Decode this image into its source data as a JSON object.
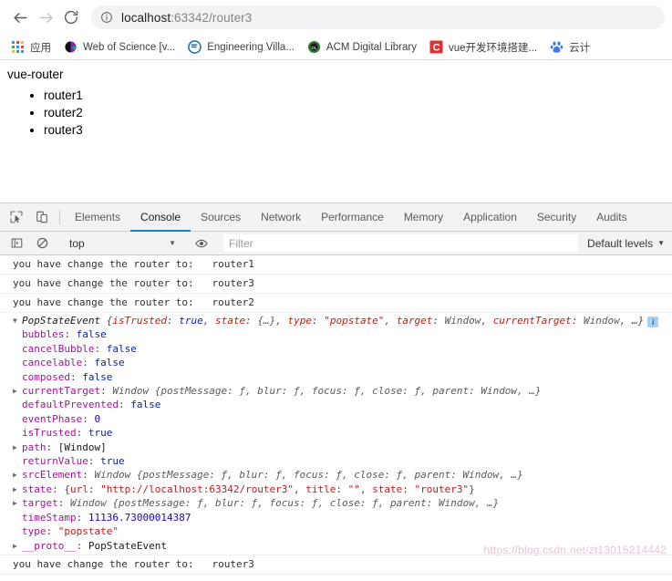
{
  "browser": {
    "back_label": "Back",
    "forward_label": "Forward",
    "reload_label": "Reload",
    "site_info_label": "View site information",
    "url_host": "localhost",
    "url_rest": ":63342/router3",
    "url_full": "localhost:63342/router3"
  },
  "bookmarks": {
    "apps_label": "应用",
    "items": [
      {
        "label": "Web of Science [v...",
        "icon": "wos-icon",
        "color": "#6b2fa0"
      },
      {
        "label": "Engineering Villa...",
        "icon": "ev-icon",
        "color": "#0a6eb4"
      },
      {
        "label": "ACM Digital Library",
        "icon": "acm-icon",
        "color": "#2f7d32"
      },
      {
        "label": "vue开发环境搭建...",
        "icon": "csdn-icon",
        "color": "#e03131"
      },
      {
        "label": "云计",
        "icon": "baidu-icon",
        "color": "#3b7de0"
      }
    ]
  },
  "page": {
    "title": "vue-router",
    "links": [
      "router1",
      "router2",
      "router3"
    ]
  },
  "devtools": {
    "inspect_label": "Inspect element",
    "device_label": "Toggle device toolbar",
    "tabs": [
      {
        "label": "Elements",
        "active": false
      },
      {
        "label": "Console",
        "active": true
      },
      {
        "label": "Sources",
        "active": false
      },
      {
        "label": "Network",
        "active": false
      },
      {
        "label": "Performance",
        "active": false
      },
      {
        "label": "Memory",
        "active": false
      },
      {
        "label": "Application",
        "active": false
      },
      {
        "label": "Security",
        "active": false
      },
      {
        "label": "Audits",
        "active": false
      }
    ],
    "toolbar": {
      "sidebar_toggle_label": "Show console sidebar",
      "clear_label": "Clear console",
      "context": "top",
      "eye_label": "Create live expression",
      "filter_value": "",
      "filter_placeholder": "Filter",
      "levels_label": "Default levels",
      "caret": "▼"
    }
  },
  "console": {
    "messages": [
      {
        "kind": "log",
        "text": "you have change the router to:   router1"
      },
      {
        "kind": "log",
        "text": "you have change the router to:   router3"
      },
      {
        "kind": "log",
        "text": "you have change the router to:   router2"
      }
    ],
    "object_header": {
      "arrow": "▼",
      "class_name": "PopStateEvent",
      "preview_open": " {",
      "parts": [
        {
          "key": "isTrusted",
          "sep": ": ",
          "val": "true",
          "type": "bool",
          "tail": ", "
        },
        {
          "key": "state",
          "sep": ": ",
          "val": "{…}",
          "type": "obj",
          "tail": ", "
        },
        {
          "key": "type",
          "sep": ": ",
          "val": "\"popstate\"",
          "type": "str",
          "tail": ", "
        },
        {
          "key": "target",
          "sep": ": ",
          "val": "Window",
          "type": "objname",
          "tail": ", "
        },
        {
          "key": "currentTarget",
          "sep": ": ",
          "val": "Window",
          "type": "objname",
          "tail": ", "
        }
      ],
      "ellipsis": "…}",
      "info_badge": "i"
    },
    "properties": [
      {
        "expandable": false,
        "key": "bubbles",
        "val": "false",
        "type": "bool"
      },
      {
        "expandable": false,
        "key": "cancelBubble",
        "val": "false",
        "type": "bool"
      },
      {
        "expandable": false,
        "key": "cancelable",
        "val": "false",
        "type": "bool"
      },
      {
        "expandable": false,
        "key": "composed",
        "val": "false",
        "type": "bool"
      },
      {
        "expandable": true,
        "key": "currentTarget",
        "val": "Window {postMessage: ƒ, blur: ƒ, focus: ƒ, close: ƒ, parent: Window, …}",
        "type": "window"
      },
      {
        "expandable": false,
        "key": "defaultPrevented",
        "val": "false",
        "type": "bool"
      },
      {
        "expandable": false,
        "key": "eventPhase",
        "val": "0",
        "type": "num"
      },
      {
        "expandable": false,
        "key": "isTrusted",
        "val": "true",
        "type": "bool"
      },
      {
        "expandable": true,
        "key": "path",
        "val": "[Window]",
        "type": "plain"
      },
      {
        "expandable": false,
        "key": "returnValue",
        "val": "true",
        "type": "bool"
      },
      {
        "expandable": true,
        "key": "srcElement",
        "val": "Window {postMessage: ƒ, blur: ƒ, focus: ƒ, close: ƒ, parent: Window, …}",
        "type": "window"
      },
      {
        "expandable": true,
        "key": "state",
        "val": "{url: \"http://localhost:63342/router3\", title: \"\", state: \"router3\"}",
        "type": "state"
      },
      {
        "expandable": true,
        "key": "target",
        "val": "Window {postMessage: ƒ, blur: ƒ, focus: ƒ, close: ƒ, parent: Window, …}",
        "type": "window"
      },
      {
        "expandable": false,
        "key": "timeStamp",
        "val": "11136.73000014387",
        "type": "num"
      },
      {
        "expandable": false,
        "key": "type",
        "val": "\"popstate\"",
        "type": "str"
      },
      {
        "expandable": true,
        "key": "__proto__",
        "val": "PopStateEvent",
        "type": "proto"
      }
    ],
    "trailing_messages": [
      {
        "kind": "log",
        "text": "you have change the router to:   router3"
      }
    ],
    "state_detail": {
      "url_key": "url",
      "url_value": "\"http://localhost:63342/router3\"",
      "title_key": "title",
      "title_value": "\"\"",
      "state_key": "state",
      "state_value": "\"router3\""
    }
  },
  "watermark": "https://blog.csdn.net/zt13015214442",
  "colors": {
    "accent": "#1a7fd4",
    "chrome_bg": "#f3f3f3",
    "link": "#0d22aa",
    "string": "#c41a16",
    "property": "#a0149b"
  }
}
